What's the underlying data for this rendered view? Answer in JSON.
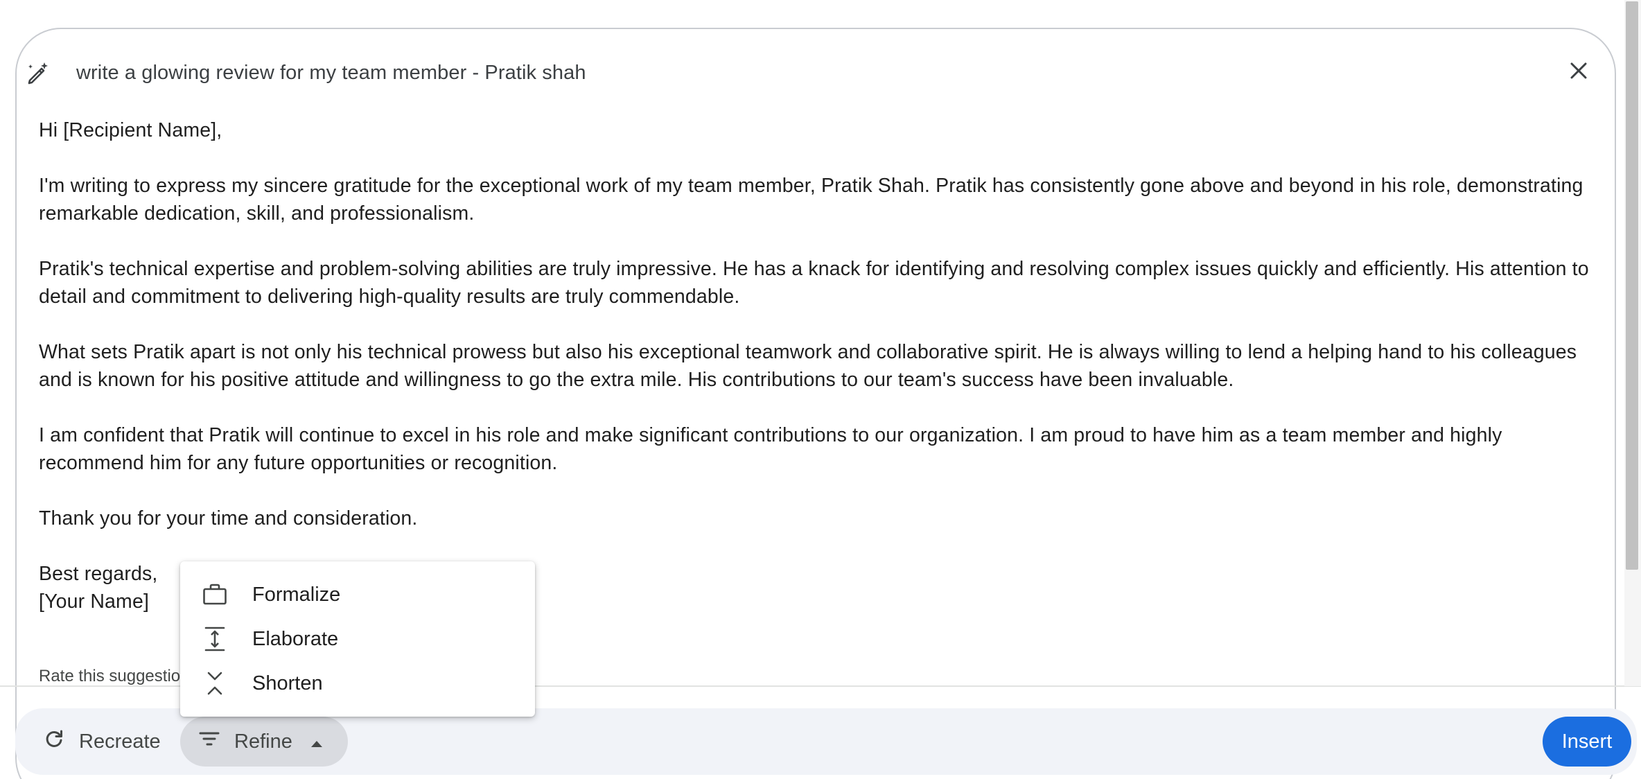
{
  "prompt": {
    "text": "write a glowing review for my team member - Pratik shah",
    "icon": "magic-wand-pen-icon"
  },
  "close": {
    "icon": "close-icon"
  },
  "draft": {
    "greeting": "Hi [Recipient Name],",
    "paragraphs": [
      "I'm writing to express my sincere gratitude for the exceptional work of my team member, Pratik Shah. Pratik has consistently gone above and beyond in his role, demonstrating remarkable dedication, skill, and professionalism.",
      "Pratik's technical expertise and problem-solving abilities are truly impressive. He has a knack for identifying and resolving complex issues quickly and efficiently. His attention to detail and commitment to delivering high-quality results are truly commendable.",
      "What sets Pratik apart is not only his technical prowess but also his exceptional teamwork and collaborative spirit. He is always willing to lend a helping hand to his colleagues and is known for his positive attitude and willingness to go the extra mile. His contributions to our team's success have been invaluable.",
      "I am confident that Pratik will continue to excel in his role and make significant contributions to our organization. I am proud to have him as a team member and highly recommend him for any future opportunities or recognition.",
      "Thank you for your time and consideration."
    ],
    "signoff": "Best regards,",
    "signature": "[Your Name]"
  },
  "rate": {
    "text": "Rate this suggestion"
  },
  "footer": {
    "recreate": {
      "label": "Recreate",
      "icon": "refresh-icon"
    },
    "refine": {
      "label": "Refine",
      "icon": "filter-list-icon",
      "caret": "caret-up-icon"
    },
    "insert": {
      "label": "Insert"
    }
  },
  "refine_menu": {
    "items": [
      {
        "label": "Formalize",
        "icon": "briefcase-icon"
      },
      {
        "label": "Elaborate",
        "icon": "expand-vertical-icon"
      },
      {
        "label": "Shorten",
        "icon": "collapse-vertical-icon"
      }
    ]
  },
  "colors": {
    "accent": "#1b6ee0",
    "footer_bg": "#f1f3f8",
    "refine_active_bg": "#d9dbe0"
  }
}
